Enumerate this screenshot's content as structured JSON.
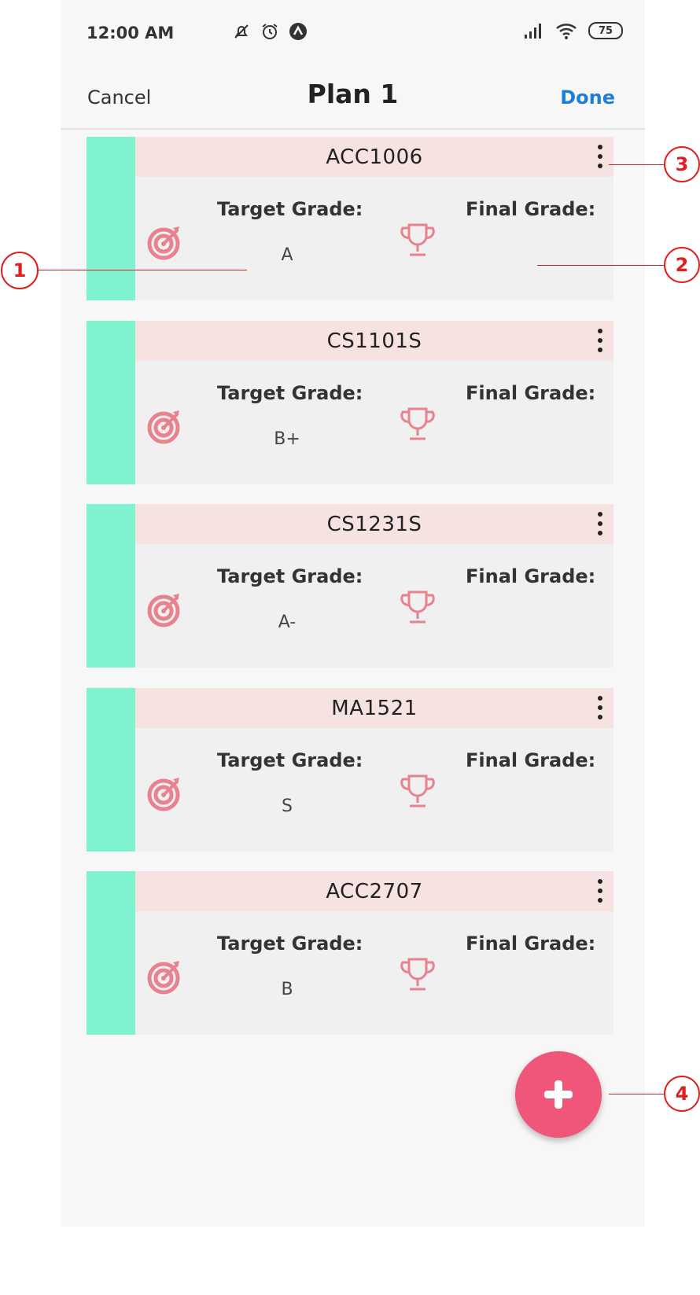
{
  "status": {
    "time": "12:00 AM",
    "battery": "75",
    "icons_left": [
      "mute-icon",
      "alarm-icon",
      "app-notification-icon"
    ],
    "icons_right": [
      "signal-icon",
      "wifi-icon",
      "battery-icon"
    ]
  },
  "navbar": {
    "cancel_label": "Cancel",
    "title": "Plan 1",
    "done_label": "Done"
  },
  "cards": [
    {
      "code": "ACC1006",
      "target_label": "Target Grade:",
      "final_label": "Final Grade:",
      "target_value": "A",
      "final_value": ""
    },
    {
      "code": "CS1101S",
      "target_label": "Target Grade:",
      "final_label": "Final Grade:",
      "target_value": "B+",
      "final_value": ""
    },
    {
      "code": "CS1231S",
      "target_label": "Target Grade:",
      "final_label": "Final Grade:",
      "target_value": "A-",
      "final_value": ""
    },
    {
      "code": "MA1521",
      "target_label": "Target Grade:",
      "final_label": "Final Grade:",
      "target_value": "S",
      "final_value": ""
    },
    {
      "code": "ACC2707",
      "target_label": "Target Grade:",
      "final_label": "Final Grade:",
      "target_value": "B",
      "final_value": ""
    }
  ],
  "fab": {
    "icon": "plus-icon"
  },
  "callouts": [
    "1",
    "2",
    "3",
    "4"
  ],
  "colors": {
    "strip": "#7ff2cf",
    "header_bg": "#f7e2e2",
    "card_bg": "#f0f0f0",
    "icon_pink": "#e8828f",
    "fab": "#f0567a",
    "done": "#1e7fd8",
    "callout": "#e01e1e"
  }
}
